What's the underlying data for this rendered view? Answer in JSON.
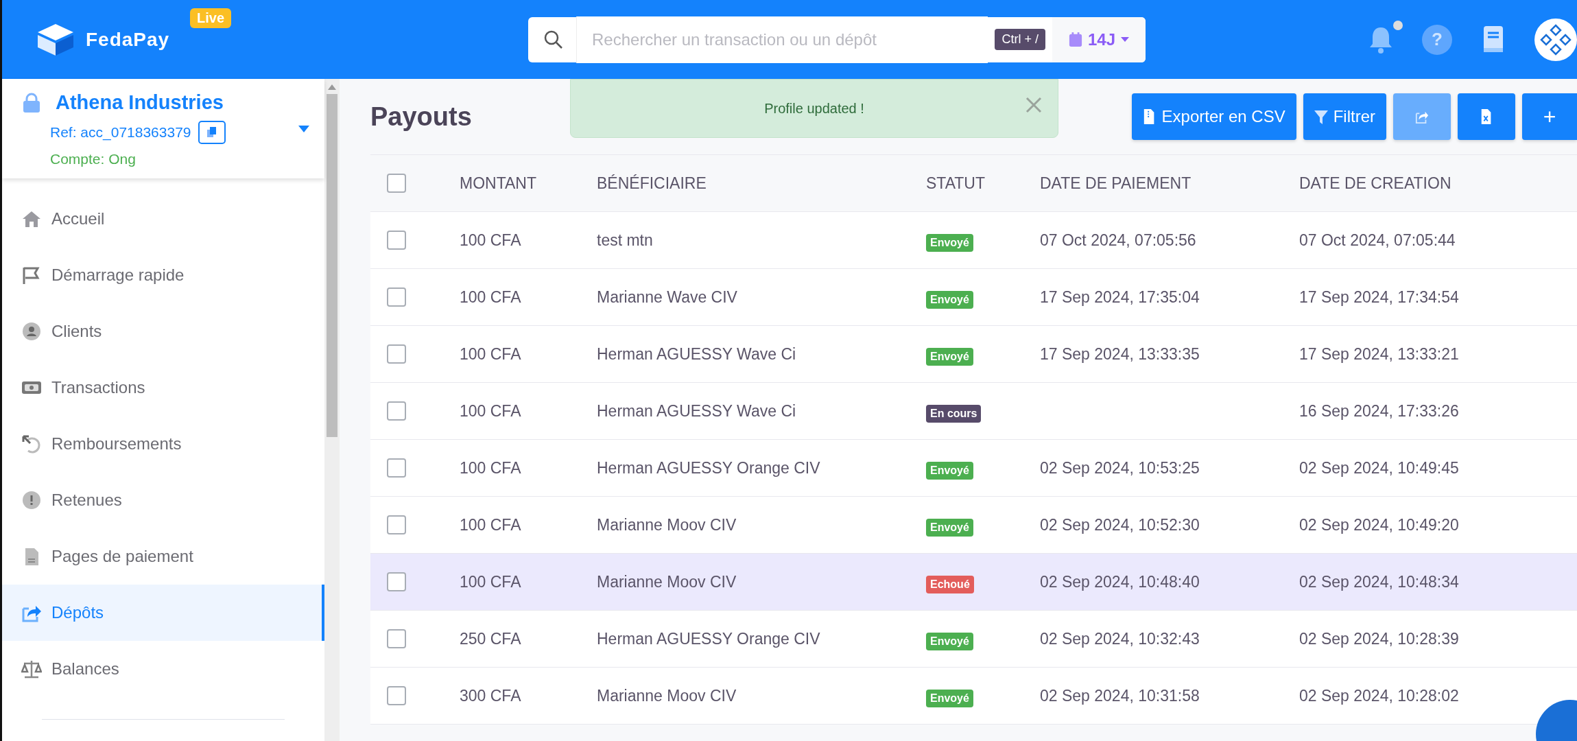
{
  "header": {
    "brand": "FedaPay",
    "mode_badge": "Live",
    "search": {
      "placeholder": "Rechercher un transaction ou un dépôt"
    },
    "shortcut": "Ctrl + /",
    "period": "14J",
    "notification_dot": true,
    "help_label": "?"
  },
  "sidebar": {
    "account": {
      "name": "Athena Industries",
      "ref": "Ref: acc_0718363379",
      "type": "Compte: Ong"
    },
    "items": [
      {
        "label": "Accueil",
        "selected": false
      },
      {
        "label": "Démarrage rapide",
        "selected": false
      },
      {
        "label": "Clients",
        "selected": false
      },
      {
        "label": "Transactions",
        "selected": false
      },
      {
        "label": "Remboursements",
        "selected": false
      },
      {
        "label": "Retenues",
        "selected": false
      },
      {
        "label": "Pages de paiement",
        "selected": false
      },
      {
        "label": "Dépôts",
        "selected": true
      },
      {
        "label": "Balances",
        "selected": false
      }
    ]
  },
  "page": {
    "title": "Payouts",
    "toast": {
      "message": "Profile updated !"
    },
    "buttons": [
      {
        "kind": "export",
        "label": "Exporter en CSV",
        "disabled": false
      },
      {
        "kind": "filter",
        "label": "Filtrer",
        "disabled": false
      },
      {
        "kind": "share",
        "disabled": true
      },
      {
        "kind": "excel",
        "disabled": false
      },
      {
        "kind": "add",
        "label": "+",
        "disabled": false
      }
    ]
  },
  "table": {
    "columns": [
      "MONTANT",
      "BÉNÉFICIAIRE",
      "STATUT",
      "DATE DE PAIEMENT",
      "DATE DE CREATION"
    ],
    "header_checked": false,
    "rows": [
      {
        "checked": false,
        "selected": false,
        "amount": "100 CFA",
        "beneficiary": "test mtn",
        "status": {
          "kind": "sent",
          "label": "Envoyé"
        },
        "paid_at": "07 Oct 2024, 07:05:56",
        "created_at": "07 Oct 2024, 07:05:44"
      },
      {
        "checked": false,
        "selected": false,
        "amount": "100 CFA",
        "beneficiary": "Marianne Wave CIV",
        "status": {
          "kind": "sent",
          "label": "Envoyé"
        },
        "paid_at": "17 Sep 2024, 17:35:04",
        "created_at": "17 Sep 2024, 17:34:54"
      },
      {
        "checked": false,
        "selected": false,
        "amount": "100 CFA",
        "beneficiary": "Herman AGUESSY Wave Ci",
        "status": {
          "kind": "sent",
          "label": "Envoyé"
        },
        "paid_at": "17 Sep 2024, 13:33:35",
        "created_at": "17 Sep 2024, 13:33:21"
      },
      {
        "checked": false,
        "selected": false,
        "amount": "100 CFA",
        "beneficiary": "Herman AGUESSY Wave Ci",
        "status": {
          "kind": "pending",
          "label": "En cours"
        },
        "created_at": "16 Sep 2024, 17:33:26"
      },
      {
        "checked": false,
        "selected": false,
        "amount": "100 CFA",
        "beneficiary": "Herman AGUESSY Orange CIV",
        "status": {
          "kind": "sent",
          "label": "Envoyé"
        },
        "paid_at": "02 Sep 2024, 10:53:25",
        "created_at": "02 Sep 2024, 10:49:45"
      },
      {
        "checked": false,
        "selected": false,
        "amount": "100 CFA",
        "beneficiary": "Marianne Moov CIV",
        "status": {
          "kind": "sent",
          "label": "Envoyé"
        },
        "paid_at": "02 Sep 2024, 10:52:30",
        "created_at": "02 Sep 2024, 10:49:20"
      },
      {
        "checked": false,
        "selected": true,
        "amount": "100 CFA",
        "beneficiary": "Marianne Moov CIV",
        "status": {
          "kind": "failed",
          "label": "Echoué"
        },
        "paid_at": "02 Sep 2024, 10:48:40",
        "created_at": "02 Sep 2024, 10:48:34"
      },
      {
        "checked": false,
        "selected": false,
        "amount": "250 CFA",
        "beneficiary": "Herman AGUESSY Orange CIV",
        "status": {
          "kind": "sent",
          "label": "Envoyé"
        },
        "paid_at": "02 Sep 2024, 10:32:43",
        "created_at": "02 Sep 2024, 10:28:39"
      },
      {
        "checked": false,
        "selected": false,
        "amount": "300 CFA",
        "beneficiary": "Marianne Moov CIV",
        "status": {
          "kind": "sent",
          "label": "Envoyé"
        },
        "paid_at": "02 Sep 2024, 10:31:58",
        "created_at": "02 Sep 2024, 10:28:02"
      }
    ]
  }
}
